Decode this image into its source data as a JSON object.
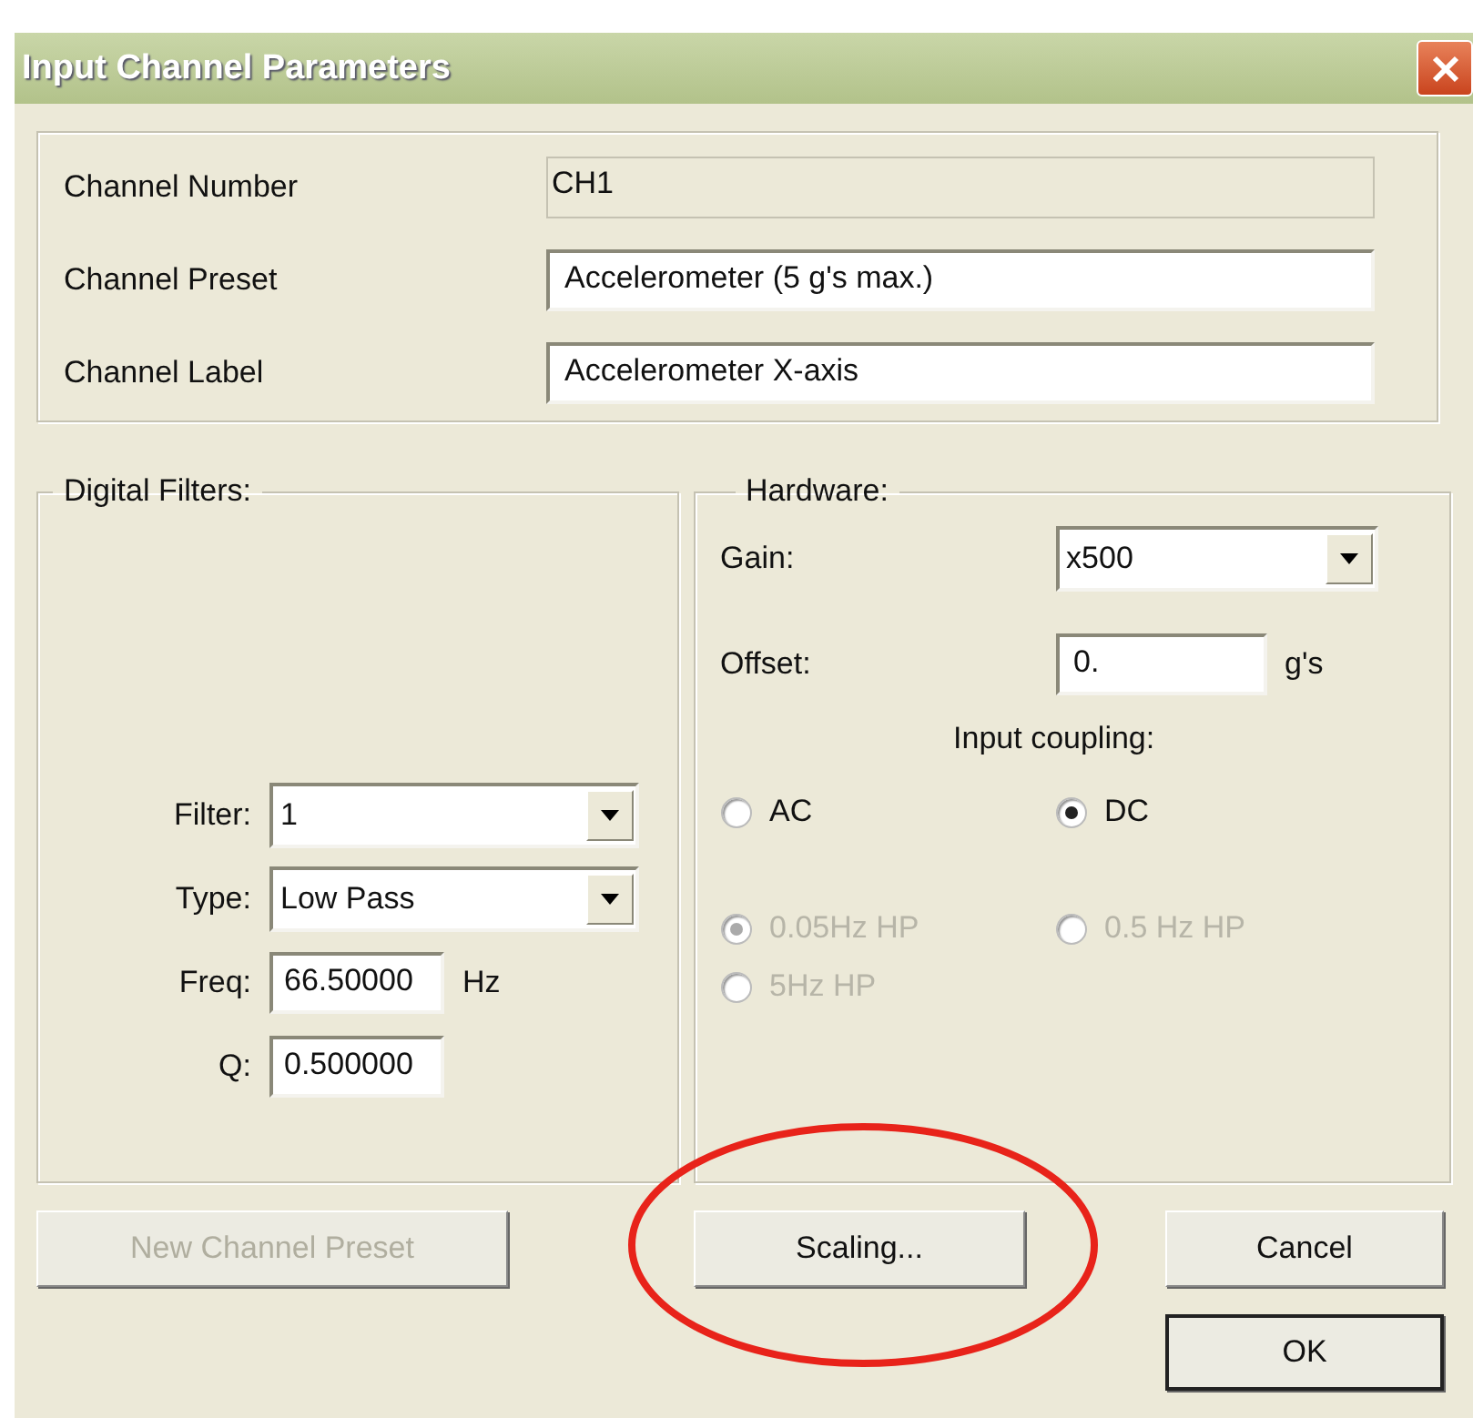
{
  "window": {
    "title": "Input Channel Parameters"
  },
  "channel": {
    "fields": [
      {
        "label": "Channel Number",
        "value": "CH1",
        "disabled": true
      },
      {
        "label": "Channel Preset",
        "value": "Accelerometer (5 g's max.)",
        "disabled": false
      },
      {
        "label": "Channel Label",
        "value": "Accelerometer X-axis",
        "disabled": false
      }
    ]
  },
  "digital_filters": {
    "title": "Digital Filters:",
    "rows": [
      {
        "kind": "combo",
        "label": "Filter:",
        "value": "1"
      },
      {
        "kind": "combo",
        "label": "Type:",
        "value": "Low Pass"
      },
      {
        "kind": "field",
        "label": "Freq:",
        "value": "66.50000",
        "unit": "Hz"
      },
      {
        "kind": "field",
        "label": "Q:",
        "value": "0.500000"
      }
    ]
  },
  "hardware": {
    "title": "Hardware:",
    "gain": {
      "label": "Gain:",
      "value": "x500"
    },
    "offset": {
      "label": "Offset:",
      "value": "0.",
      "unit": "g's"
    },
    "coupling_label": "Input coupling:",
    "coupling": [
      {
        "label": "AC",
        "selected": false,
        "disabled": false
      },
      {
        "label": "DC",
        "selected": true,
        "disabled": false
      }
    ],
    "highpass": [
      {
        "label": "0.05Hz HP",
        "selected": true,
        "disabled": true
      },
      {
        "label": "0.5 Hz HP",
        "selected": false,
        "disabled": true
      },
      {
        "label": "5Hz HP",
        "selected": false,
        "disabled": true
      }
    ]
  },
  "buttons": [
    {
      "label": "New Channel Preset",
      "disabled": true,
      "default": false
    },
    {
      "label": "Scaling...",
      "disabled": false,
      "default": false
    },
    {
      "label": "Cancel",
      "disabled": false,
      "default": false
    },
    {
      "label": "OK",
      "disabled": false,
      "default": true
    }
  ]
}
